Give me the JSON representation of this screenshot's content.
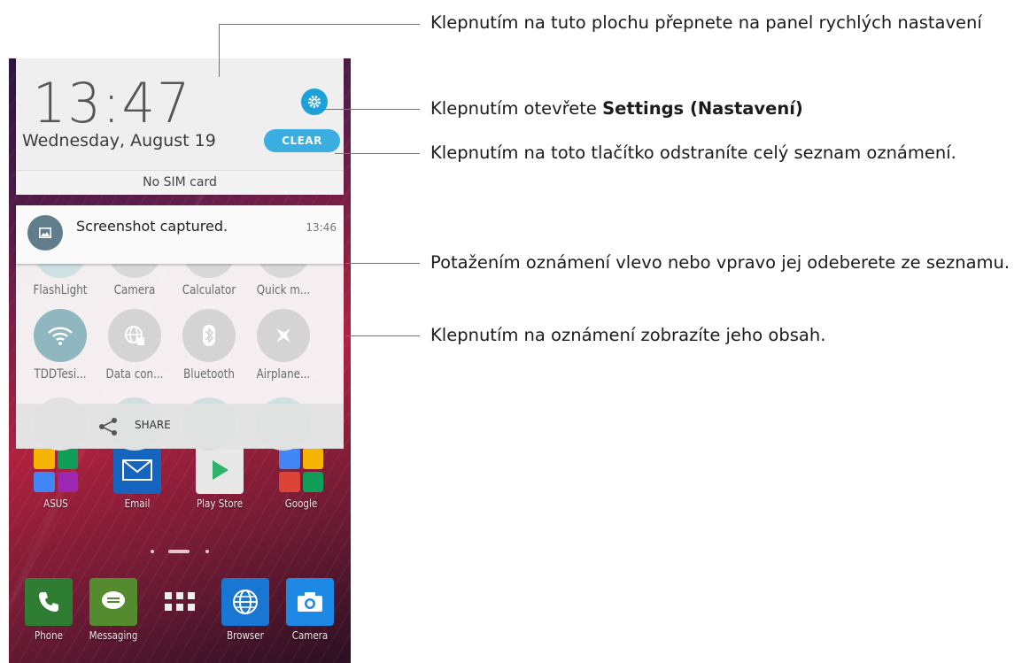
{
  "status": {
    "time": "13:47",
    "date": "Wednesday, August 19",
    "clear_label": "CLEAR",
    "sim_text": "No SIM card"
  },
  "notification": {
    "title": "Screenshot captured.",
    "time": "13:46"
  },
  "quick_settings": {
    "row1": [
      "FlashLight",
      "Camera",
      "Calculator",
      "Quick m..."
    ],
    "row2": [
      "TDDTesi...",
      "Data con...",
      "Bluetooth",
      "Airplane..."
    ],
    "share_label": "SHARE"
  },
  "home": {
    "row1": [
      "ASUS",
      "Email",
      "Play Store",
      "Google"
    ],
    "dock": [
      "Phone",
      "Messaging",
      "Browser",
      "Camera"
    ]
  },
  "callouts": {
    "c1": "Klepnutím na tuto plochu přepnete na panel rychlých nastavení",
    "c2_prefix": "Klepnutím otevřete ",
    "c2_bold": "Settings (Nastavení)",
    "c3": "Klepnutím na toto tlačítko odstraníte celý seznam oznámení.",
    "c4": "Potažením oznámení vlevo nebo vpravo jej odeberete ze seznamu.",
    "c5": "Klepnutím na oznámení zobrazíte jeho obsah."
  },
  "colors": {
    "accent": "#1ea1d8",
    "callout_line": "#1a8fc9",
    "notification_icon_bg": "#607d8b"
  }
}
